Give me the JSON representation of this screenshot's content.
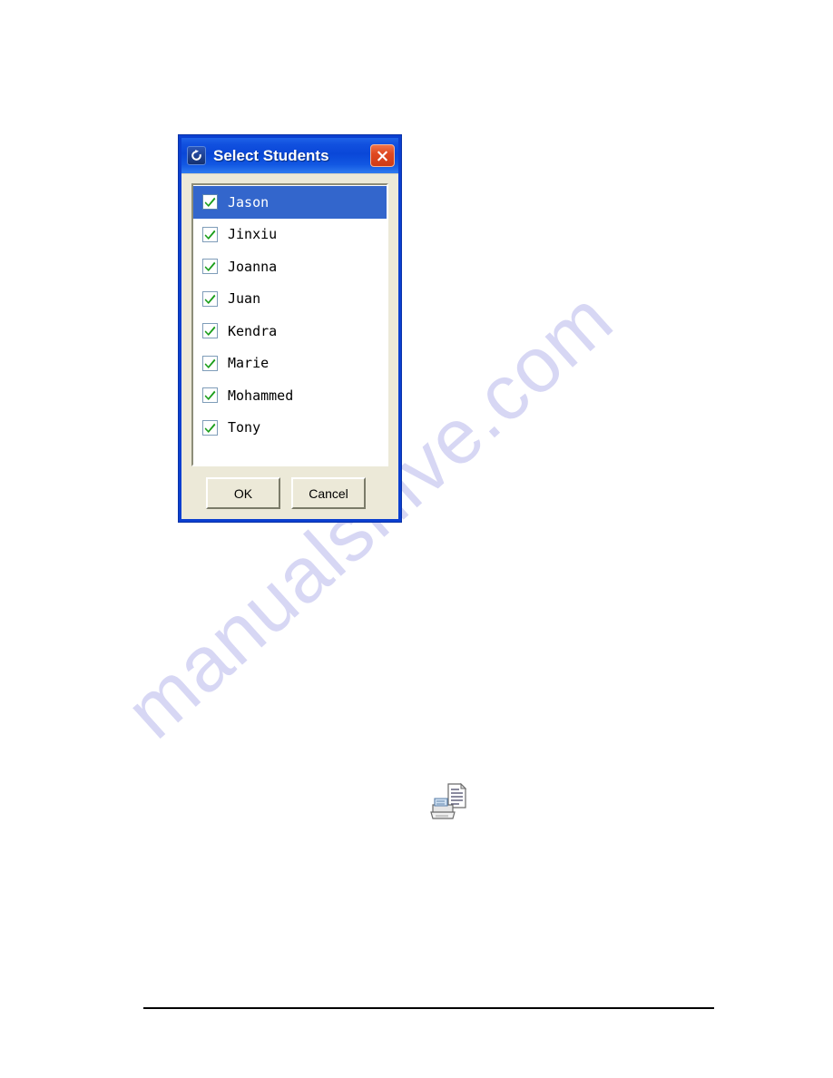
{
  "page": {
    "background_color": "#ffffff",
    "watermark_text": "manualshive.com",
    "watermark_color": "#d7d7f4"
  },
  "dialog": {
    "title": "Select Students",
    "app_icon": "app-logo-icon",
    "close_icon": "close-icon",
    "titlebar_color": "#0a47d8",
    "body_color": "#ece9d8",
    "selection_color": "#3366cc",
    "students": [
      {
        "name": "Jason",
        "checked": true,
        "selected": true
      },
      {
        "name": "Jinxiu",
        "checked": true,
        "selected": false
      },
      {
        "name": "Joanna",
        "checked": true,
        "selected": false
      },
      {
        "name": "Juan",
        "checked": true,
        "selected": false
      },
      {
        "name": "Kendra",
        "checked": true,
        "selected": false
      },
      {
        "name": "Marie",
        "checked": true,
        "selected": false
      },
      {
        "name": "Mohammed",
        "checked": true,
        "selected": false
      },
      {
        "name": "Tony",
        "checked": true,
        "selected": false
      }
    ],
    "buttons": {
      "ok_label": "OK",
      "cancel_label": "Cancel"
    },
    "checkmark_color": "#1a9e1a"
  },
  "printer": {
    "icon": "printer-icon"
  }
}
